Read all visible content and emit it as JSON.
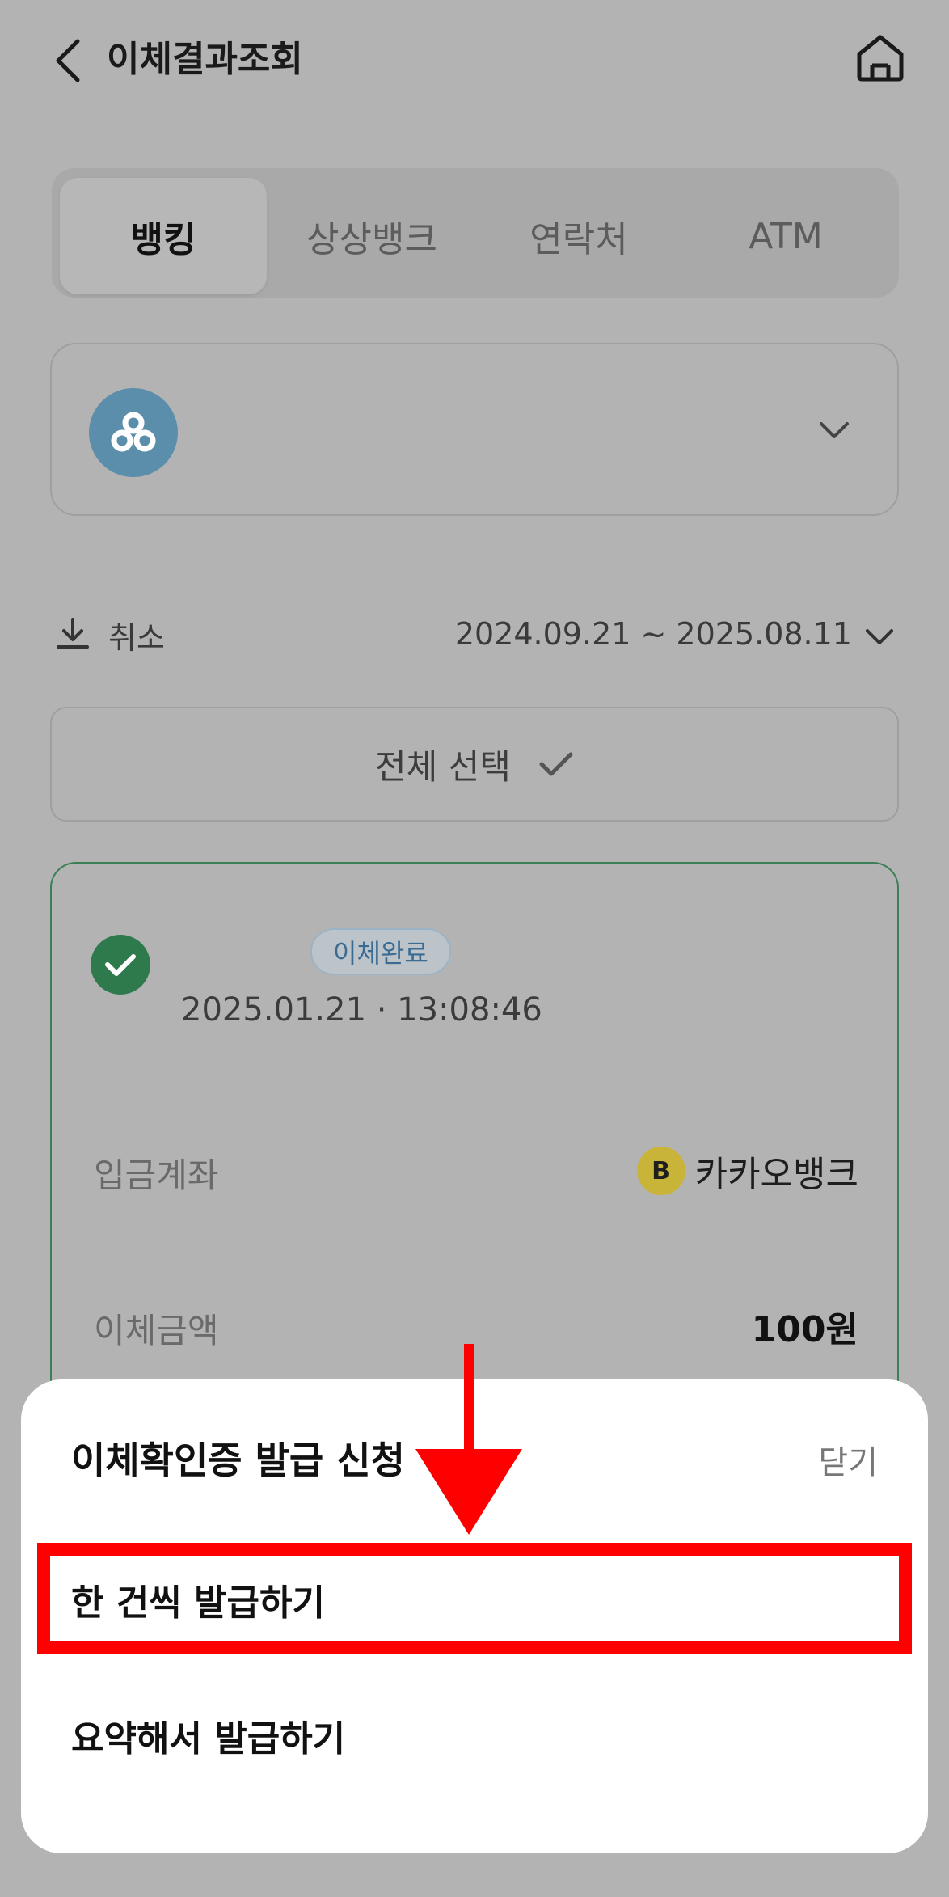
{
  "header": {
    "title": "이체결과조회",
    "back_icon": "chevron-left-icon",
    "home_icon": "home-icon"
  },
  "tabs": [
    {
      "label": "뱅킹",
      "active": true
    },
    {
      "label": "상상뱅크",
      "active": false
    },
    {
      "label": "연락처",
      "active": false
    },
    {
      "label": "ATM",
      "active": false
    }
  ],
  "account_selector": {
    "logo_icon": "bank-logo-icon",
    "chevron_icon": "chevron-down-icon"
  },
  "filter": {
    "cancel_label": "취소",
    "date_range": "2024.09.21 ~ 2025.08.11"
  },
  "select_all": {
    "label": "전체 선택"
  },
  "transaction": {
    "badge": "이체완료",
    "datetime": "2025.01.21 · 13:08:46",
    "deposit_label": "입금계좌",
    "bank_logo_letter": "B",
    "bank_name": "카카오뱅크",
    "amount_label": "이체금액",
    "amount": "100원"
  },
  "sheet": {
    "title": "이체확인증 발급 신청",
    "close_label": "닫기",
    "options": [
      {
        "label": "한 건씩 발급하기"
      },
      {
        "label": "요약해서 발급하기"
      }
    ]
  },
  "colors": {
    "overlay": "#b3b3b3",
    "success_green": "#2f7a4c",
    "annotation_red": "#ff0000",
    "badge_text": "#3a6b93"
  }
}
